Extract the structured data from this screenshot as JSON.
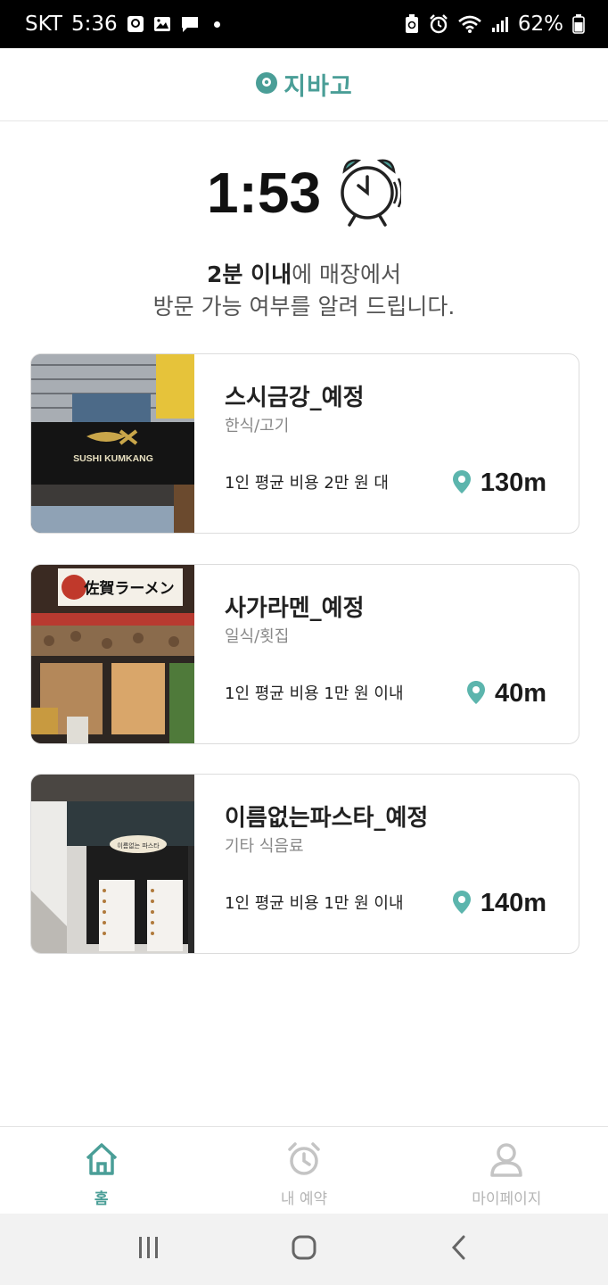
{
  "status_bar": {
    "carrier": "SKT",
    "time": "5:36",
    "battery": "62%"
  },
  "header": {
    "logo_text": "지바고",
    "brand_color": "#4a9e97"
  },
  "timer": {
    "value": "1:53"
  },
  "notice": {
    "bold": "2분 이내",
    "rest_line1": "에 매장에서",
    "line2": "방문 가능 여부를 알려 드립니다."
  },
  "stores": [
    {
      "name": "스시금강_예정",
      "category": "한식/고기",
      "cost": "1인 평균 비용 2만 원 대",
      "distance": "130m",
      "sign_text": "SUSHI KUMKANG"
    },
    {
      "name": "사가라멘_예정",
      "category": "일식/횟집",
      "cost": "1인 평균 비용 1만 원 이내",
      "distance": "40m",
      "sign_text": "佐賀ラーメン"
    },
    {
      "name": "이름없는파스타_예정",
      "category": "기타 식음료",
      "cost": "1인 평균 비용 1만 원 이내",
      "distance": "140m",
      "sign_text": "이름없는 파스타"
    }
  ],
  "bottom_nav": [
    {
      "label": "홈",
      "icon": "home-icon",
      "active": true
    },
    {
      "label": "내 예약",
      "icon": "alarm-clock-icon",
      "active": false
    },
    {
      "label": "마이페이지",
      "icon": "person-icon",
      "active": false
    }
  ]
}
